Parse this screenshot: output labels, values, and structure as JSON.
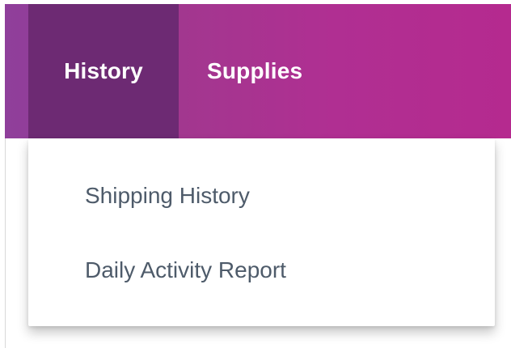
{
  "nav": {
    "items": [
      {
        "label": "History",
        "active": true
      },
      {
        "label": "Supplies",
        "active": false
      }
    ]
  },
  "dropdown": {
    "items": [
      {
        "label": "Shipping History"
      },
      {
        "label": "Daily Activity Report"
      }
    ]
  },
  "colors": {
    "navbar_start": "#8f3f9b",
    "navbar_end": "#b52a8f",
    "active_tab": "#6d2a73",
    "menu_text": "#4e5b6a"
  }
}
